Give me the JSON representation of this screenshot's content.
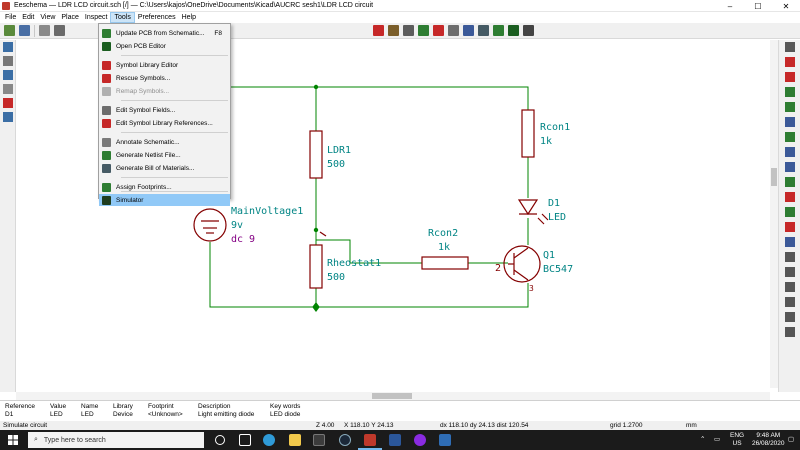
{
  "window": {
    "title": "Eeschema — LDR LCD circuit.sch [/] — C:\\Users\\kajos\\OneDrive\\Documents\\Kicad\\AUCRC sesh1\\LDR LCD circuit",
    "minimize": "–",
    "maximize": "☐",
    "close": "✕"
  },
  "menubar": [
    "File",
    "Edit",
    "View",
    "Place",
    "Inspect",
    "Tools",
    "Preferences",
    "Help"
  ],
  "active_menu": "Tools",
  "tools_menu": [
    {
      "label": "Update PCB from Schematic...",
      "shortcut": "F8",
      "icon": "update-pcb-icon",
      "color": "#2e7d32",
      "disabled": false
    },
    {
      "label": "Open PCB Editor",
      "icon": "pcb-editor-icon",
      "color": "#1b5e20",
      "disabled": false
    },
    {
      "label": "Symbol Library Editor",
      "icon": "symbol-editor-icon",
      "color": "#c62828",
      "disabled": false
    },
    {
      "label": "Rescue Symbols...",
      "icon": "rescue-icon",
      "color": "#c62828",
      "disabled": false
    },
    {
      "label": "Remap Symbols...",
      "icon": "remap-icon",
      "color": "#b0b0b0",
      "disabled": true
    },
    {
      "label": "Edit Symbol Fields...",
      "icon": "fields-icon",
      "color": "#6d6d6d",
      "disabled": false
    },
    {
      "label": "Edit Symbol Library References...",
      "icon": "lib-refs-icon",
      "color": "#c62828",
      "disabled": false
    },
    {
      "label": "Annotate Schematic...",
      "icon": "annotate-icon",
      "color": "#7a7a7a",
      "disabled": false
    },
    {
      "label": "Generate Netlist File...",
      "icon": "netlist-icon",
      "color": "#2e7d32",
      "disabled": false
    },
    {
      "label": "Generate Bill of Materials...",
      "icon": "bom-icon",
      "color": "#455a64",
      "disabled": false
    },
    {
      "label": "Assign Footprints...",
      "icon": "footprint-icon",
      "color": "#2e7d32",
      "disabled": false
    },
    {
      "label": "Simulator",
      "icon": "simulator-icon",
      "color": "#1f3d1f",
      "disabled": false,
      "highlighted": true
    }
  ],
  "schematic": {
    "colors": {
      "wire": "#008400",
      "component": "#840000",
      "ref": "#008484",
      "value": "#008484",
      "extra": "#840084"
    },
    "components": [
      {
        "ref": "MainVoltage1",
        "value": "9v",
        "extra": "dc 9"
      },
      {
        "ref": "LDR1",
        "value": "500"
      },
      {
        "ref": "Rheostat1",
        "value": "500"
      },
      {
        "ref": "Rcon1",
        "value": "1k"
      },
      {
        "ref": "Rcon2",
        "value": "1k"
      },
      {
        "ref": "D1",
        "value": "LED"
      },
      {
        "ref": "Q1",
        "value": "BC547"
      }
    ],
    "pins": {
      "base": "2",
      "emitter": "3"
    }
  },
  "info_panel": {
    "columns": [
      {
        "h": "Reference",
        "v": "D1"
      },
      {
        "h": "Value",
        "v": "LED"
      },
      {
        "h": "Name",
        "v": "LED"
      },
      {
        "h": "Library",
        "v": "Device"
      },
      {
        "h": "Footprint",
        "v": "<Unknown>"
      },
      {
        "h": "Description",
        "v": "Light emitting diode"
      },
      {
        "h": "Key words",
        "v": "LED diode"
      }
    ]
  },
  "status": {
    "message": "Simulate circuit",
    "zoom": "Z 4.00",
    "xy": "X 118.10  Y 24.13",
    "delta": "dx 118.10  dy 24.13  dist 120.54",
    "grid": "grid 1.2700",
    "units": "mm"
  },
  "taskbar": {
    "search_placeholder": "Type here to search",
    "lang_top": "ENG",
    "lang_bottom": "US",
    "time": "9:48 AM",
    "date": "26/08/2020"
  }
}
